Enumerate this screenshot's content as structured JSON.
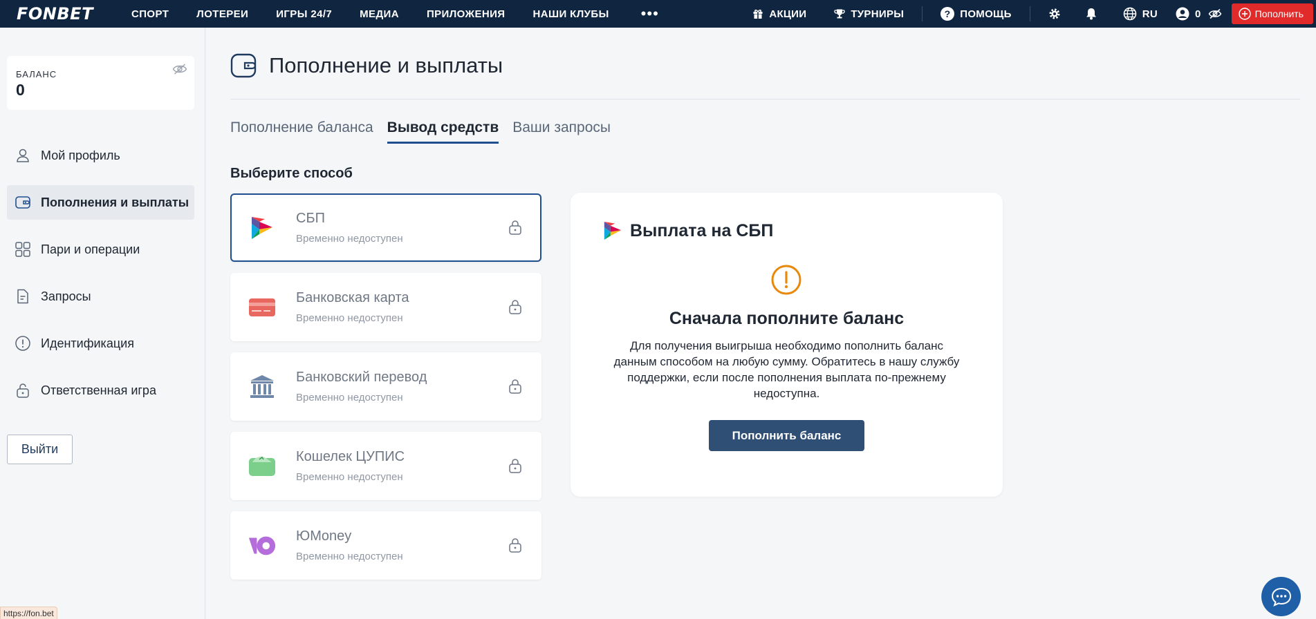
{
  "topbar": {
    "logo": "FONBET",
    "nav": [
      "СПОРТ",
      "ЛОТЕРЕИ",
      "ИГРЫ 24/7",
      "МЕДИА",
      "ПРИЛОЖЕНИЯ",
      "НАШИ КЛУБЫ"
    ],
    "more_label": "•••",
    "promos_label": "АКЦИИ",
    "tournaments_label": "ТУРНИРЫ",
    "help_label": "ПОМОЩЬ",
    "language": "RU",
    "account_count": "0",
    "deposit_label": "Пополнить"
  },
  "sidebar": {
    "balance_label": "БАЛАНС",
    "balance_value": "0",
    "items": [
      {
        "label": "Мой профиль",
        "icon": "user-icon"
      },
      {
        "label": "Пополнения и выплаты",
        "icon": "wallet-icon",
        "active": true
      },
      {
        "label": "Пари и операции",
        "icon": "grid-icon"
      },
      {
        "label": "Запросы",
        "icon": "document-icon"
      },
      {
        "label": "Идентификация",
        "icon": "info-circle-icon"
      },
      {
        "label": "Ответственная игра",
        "icon": "lock-icon"
      }
    ],
    "logout_label": "Выйти"
  },
  "status_url": "https://fon.bet",
  "main": {
    "title": "Пополнение и выплаты",
    "tabs": [
      {
        "label": "Пополнение баланса",
        "active": false
      },
      {
        "label": "Вывод средств",
        "active": true
      },
      {
        "label": "Ваши запросы",
        "active": false
      }
    ],
    "section_label": "Выберите способ",
    "methods": [
      {
        "name": "СБП",
        "status": "Временно недоступен",
        "icon": "sbp-icon",
        "selected": true
      },
      {
        "name": "Банковская карта",
        "status": "Временно недоступен",
        "icon": "bank-card-icon",
        "selected": false
      },
      {
        "name": "Банковский перевод",
        "status": "Временно недоступен",
        "icon": "bank-building-icon",
        "selected": false
      },
      {
        "name": "Кошелек ЦУПИС",
        "status": "Временно недоступен",
        "icon": "cupis-wallet-icon",
        "selected": false
      },
      {
        "name": "ЮMoney",
        "status": "Временно недоступен",
        "icon": "yoomoney-icon",
        "selected": false
      }
    ],
    "panel": {
      "title": "Выплата на СБП",
      "warning_title": "Сначала пополните баланс",
      "warning_text": "Для получения выигрыша необходимо пополнить баланс данным способом на любую сумму. Обратитесь в нашу службу поддержки, если после пополнения выплата по-прежнему недоступна.",
      "button_label": "Пополнить баланс"
    }
  },
  "colors": {
    "topbar": "#0f2540",
    "accent": "#1f4f8f",
    "deposit": "#e12b2b",
    "warning": "#e8890c",
    "button": "#2f4f74"
  }
}
